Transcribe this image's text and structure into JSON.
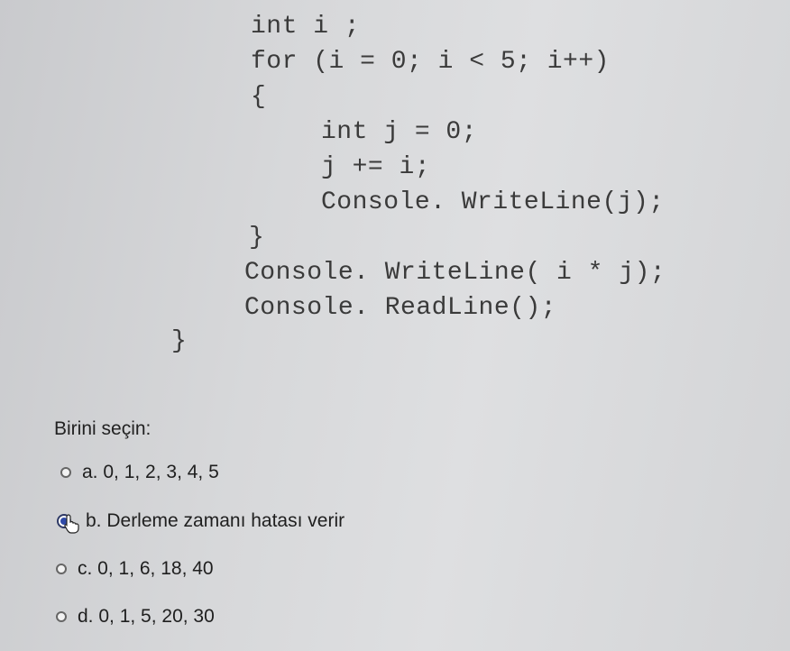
{
  "code": {
    "lines": [
      "int i ;",
      "for (i = 0; i < 5; i++)",
      "{",
      "int j = 0;",
      "j += i;",
      "Console. WriteLine(j);",
      "}",
      "Console. WriteLine( i * j);",
      "Console. ReadLine();",
      "}"
    ]
  },
  "question": {
    "prompt": "Birini seçin:",
    "options": [
      {
        "label": "a. 0, 1, 2, 3, 4, 5",
        "selected": false
      },
      {
        "label": "b. Derleme zamanı hatası verir",
        "selected": true
      },
      {
        "label": "c. 0, 1, 6, 18, 40",
        "selected": false
      },
      {
        "label": "d. 0, 1, 5, 20, 30",
        "selected": false
      }
    ]
  },
  "colors": {
    "radio_selected": "#2f4aa8",
    "background": "#d7d8da"
  },
  "icons": {
    "cursor": "hand-pointer-icon"
  }
}
